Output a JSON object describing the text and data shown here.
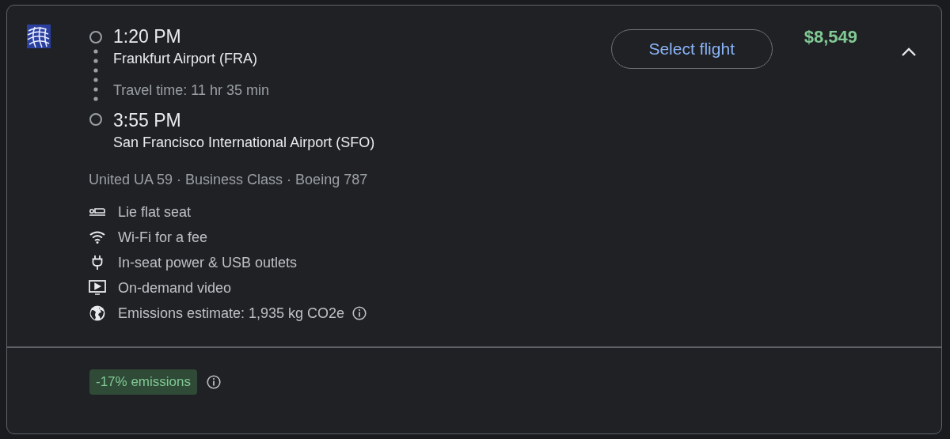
{
  "flight": {
    "departure": {
      "time": "1:20 PM",
      "airport": "Frankfurt Airport (FRA)"
    },
    "travel_time": "Travel time: 11 hr 35 min",
    "arrival": {
      "time": "3:55 PM",
      "airport": "San Francisco International Airport (SFO)"
    },
    "details": "United UA 59 · Business Class · Boeing 787",
    "amenities": [
      {
        "kind": "seat",
        "label": "Lie flat seat"
      },
      {
        "kind": "wifi",
        "label": "Wi-Fi for a fee"
      },
      {
        "kind": "power",
        "label": "In-seat power & USB outlets"
      },
      {
        "kind": "video",
        "label": "On-demand video"
      },
      {
        "kind": "emissions",
        "label": "Emissions estimate: 1,935 kg CO2e",
        "info": true
      }
    ],
    "select_button": "Select flight",
    "price": "$8,549",
    "expanded": true,
    "emissions_badge": "-17% emissions",
    "emissions_info": true
  }
}
